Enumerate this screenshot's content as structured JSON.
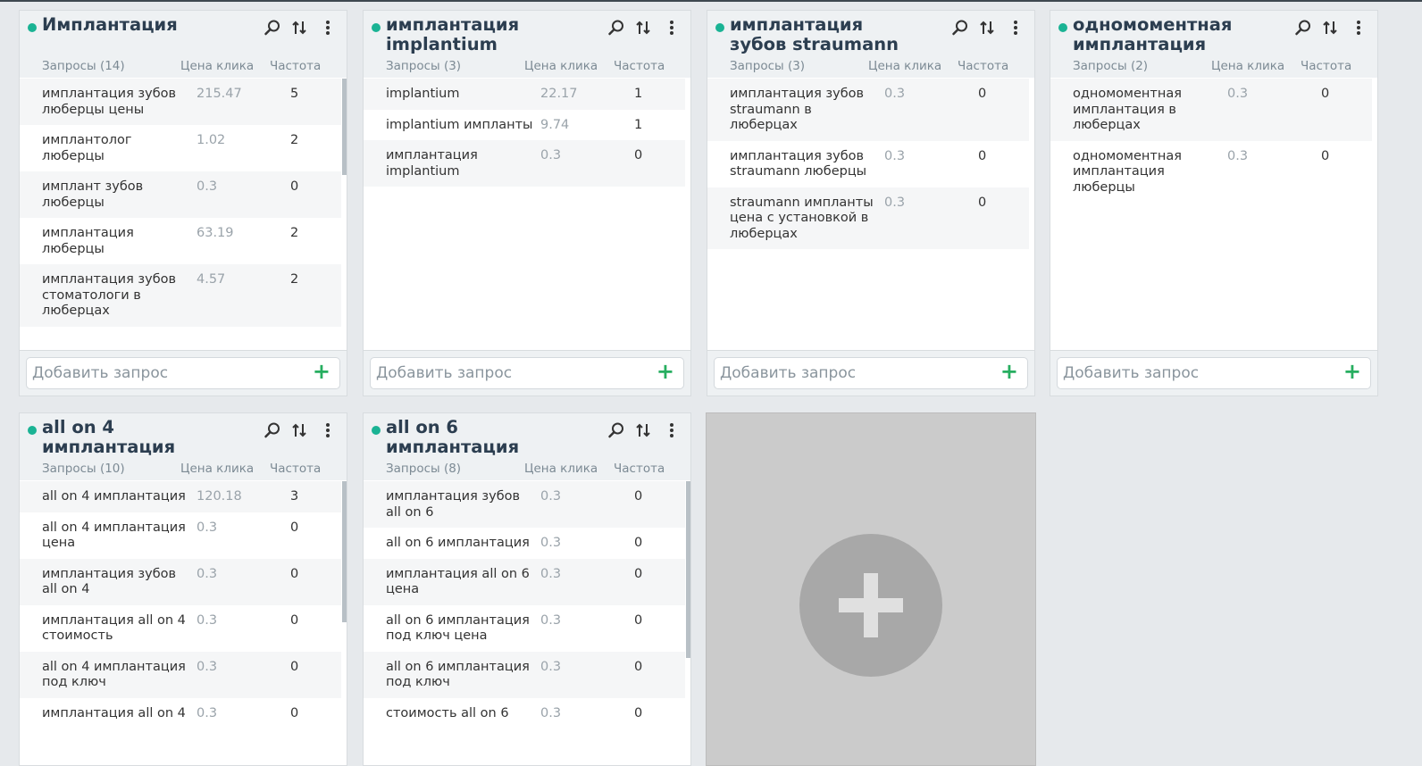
{
  "columns": {
    "queries_prefix": "Запросы",
    "price": "Цена клика",
    "freq": "Частота"
  },
  "add_placeholder": "Добавить запрос",
  "groups": [
    {
      "title": "Имплантация",
      "count_label": "Запросы (14)",
      "rows": [
        {
          "q": "имплантация зубов люберцы цены",
          "p": "215.47",
          "f": "5"
        },
        {
          "q": "имплантолог люберцы",
          "p": "1.02",
          "f": "2"
        },
        {
          "q": "имплант зубов люберцы",
          "p": "0.3",
          "f": "0"
        },
        {
          "q": "имплантация люберцы",
          "p": "63.19",
          "f": "2"
        },
        {
          "q": "имплантация зубов стоматологи в люберцах",
          "p": "4.57",
          "f": "2"
        }
      ]
    },
    {
      "title": "имплантация\nimplantium",
      "count_label": "Запросы (3)",
      "rows": [
        {
          "q": "implantium",
          "p": "22.17",
          "f": "1"
        },
        {
          "q": "implantium импланты",
          "p": "9.74",
          "f": "1"
        },
        {
          "q": "имплантация implantium",
          "p": "0.3",
          "f": "0"
        }
      ]
    },
    {
      "title": "имплантация\nзубов straumann",
      "count_label": "Запросы (3)",
      "rows": [
        {
          "q": "имплантация зубов straumann в люберцах",
          "p": "0.3",
          "f": "0"
        },
        {
          "q": "имплантация зубов straumann люберцы",
          "p": "0.3",
          "f": "0"
        },
        {
          "q": "straumann импланты цена с установкой в люберцах",
          "p": "0.3",
          "f": "0"
        }
      ]
    },
    {
      "title": "одномоментная\nимплантация",
      "count_label": "Запросы (2)",
      "rows": [
        {
          "q": "одномоментная имплантация в люберцах",
          "p": "0.3",
          "f": "0"
        },
        {
          "q": "одномоментная имплантация люберцы",
          "p": "0.3",
          "f": "0"
        }
      ]
    },
    {
      "title": "all on 4\nимплантация",
      "count_label": "Запросы (10)",
      "rows": [
        {
          "q": "all on 4 имплантация",
          "p": "120.18",
          "f": "3"
        },
        {
          "q": "all on 4 имплантация цена",
          "p": "0.3",
          "f": "0"
        },
        {
          "q": "имплантация зубов all on 4",
          "p": "0.3",
          "f": "0"
        },
        {
          "q": "имплантация all on 4 стоимость",
          "p": "0.3",
          "f": "0"
        },
        {
          "q": "all on 4 имплантация под ключ",
          "p": "0.3",
          "f": "0"
        },
        {
          "q": "имплантация all on 4",
          "p": "0.3",
          "f": "0"
        }
      ]
    },
    {
      "title": "all on 6\nимплантация",
      "count_label": "Запросы (8)",
      "rows": [
        {
          "q": "имплантация зубов all on 6",
          "p": "0.3",
          "f": "0"
        },
        {
          "q": "all on 6 имплантация",
          "p": "0.3",
          "f": "0"
        },
        {
          "q": "имплантация all on 6 цена",
          "p": "0.3",
          "f": "0"
        },
        {
          "q": "all on 6 имплантация под ключ цена",
          "p": "0.3",
          "f": "0"
        },
        {
          "q": "all on 6 имплантация под ключ",
          "p": "0.3",
          "f": "0"
        },
        {
          "q": "стоимость all on 6",
          "p": "0.3",
          "f": "0"
        }
      ]
    }
  ],
  "colors": {
    "status_dot": "#1ab394",
    "plus": "#27ae60"
  },
  "icons": [
    "search-icon",
    "sort-icon",
    "more-icon",
    "plus-icon"
  ]
}
